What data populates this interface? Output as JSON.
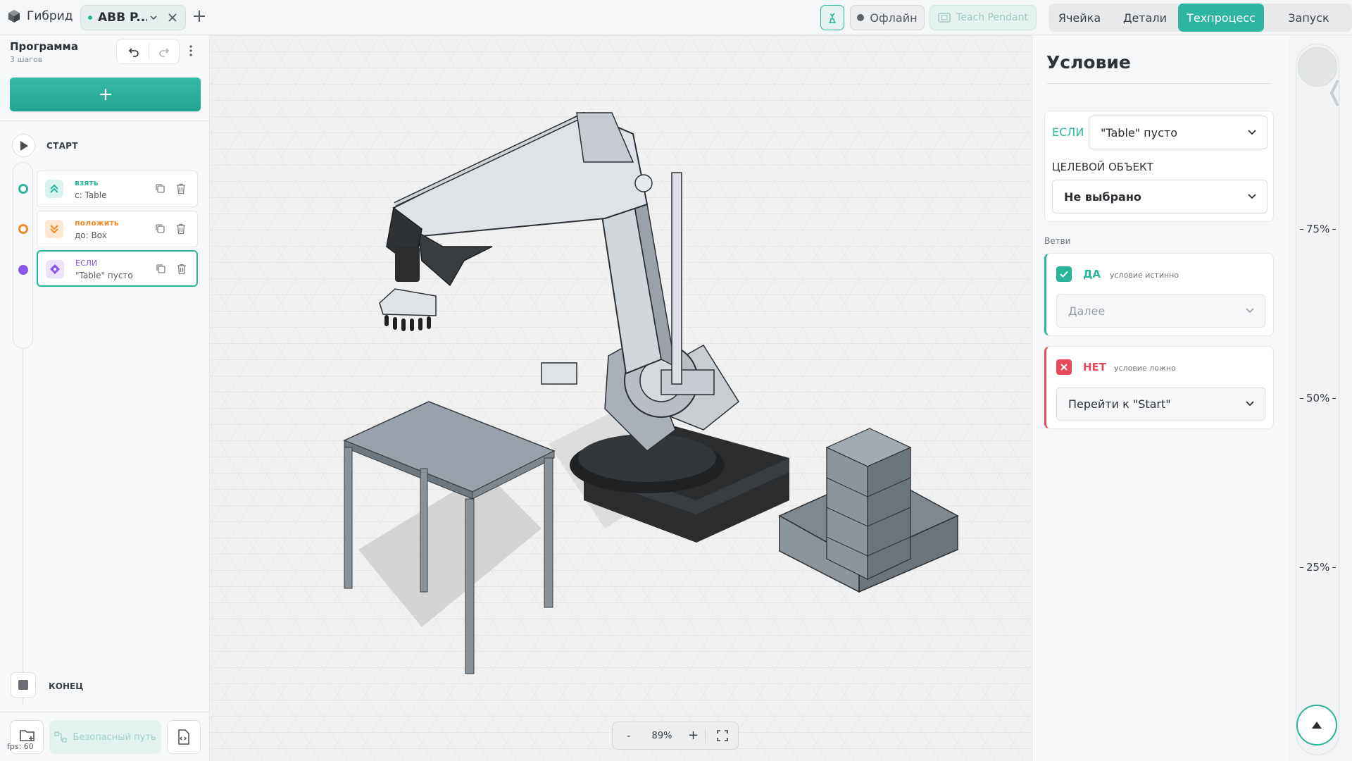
{
  "app": {
    "brand": "Гибрид"
  },
  "tabs": [
    {
      "label": "ABB P...",
      "active": true
    }
  ],
  "header": {
    "status": "Офлайн",
    "teach_pendant": "Teach Pendant",
    "nav": [
      "Ячейка",
      "Детали",
      "Техпроцесс",
      "Запуск"
    ],
    "active_nav": "Техпроцесс"
  },
  "program": {
    "title": "Программа",
    "subtitle": "3 шагов",
    "start": "СТАРТ",
    "end": "КОНЕЦ",
    "steps": [
      {
        "kind": "взять",
        "detail": "с: Table",
        "color": "#2ab59b"
      },
      {
        "kind": "положить",
        "detail": "до: Box",
        "color": "#f08a2a"
      },
      {
        "kind": "ЕСЛИ",
        "detail": "\"Table\" пусто",
        "color": "#8b57e8"
      }
    ],
    "safe_path": "Безопасный путь",
    "fps": "fps: 60"
  },
  "viewport": {
    "zoom": "89%",
    "zoom_minus": "-",
    "zoom_plus": "+"
  },
  "condition": {
    "title": "Условие",
    "if_label": "ЕСЛИ",
    "if_value": "\"Table\" пусто",
    "target_label": "ЦЕЛЕВОЙ ОБЪЕКТ",
    "target_value": "Не выбрано",
    "branches_label": "Ветви",
    "yes": {
      "label": "ДА",
      "sub": "условие истинно",
      "action_placeholder": "Далее"
    },
    "no": {
      "label": "НЕТ",
      "sub": "условие ложно",
      "action": "Перейти к \"Start\""
    }
  },
  "speed": {
    "ticks": [
      "75%",
      "50%",
      "25%"
    ]
  },
  "colors": {
    "accent": "#2eb5a0",
    "danger": "#e64a5a",
    "take": "#2ab59b",
    "place": "#f08a2a",
    "if": "#8b57e8"
  }
}
